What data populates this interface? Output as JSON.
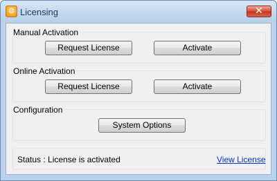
{
  "window": {
    "title": "Licensing",
    "close_glyph": "✕"
  },
  "manual": {
    "label": "Manual Activation",
    "request_label": "Request License",
    "activate_label": "Activate"
  },
  "online": {
    "label": "Online Activation",
    "request_label": "Request License",
    "activate_label": "Activate"
  },
  "configuration": {
    "label": "Configuration",
    "options_label": "System Options"
  },
  "status": {
    "text": "Status : License is activated",
    "link_label": "View License"
  },
  "colors": {
    "link": "#0033cc",
    "close_button": "#c4361f",
    "titlebar": "#c5d9ef",
    "client_bg": "#f0f0f0"
  },
  "icons": [
    "app-icon",
    "close-icon"
  ]
}
